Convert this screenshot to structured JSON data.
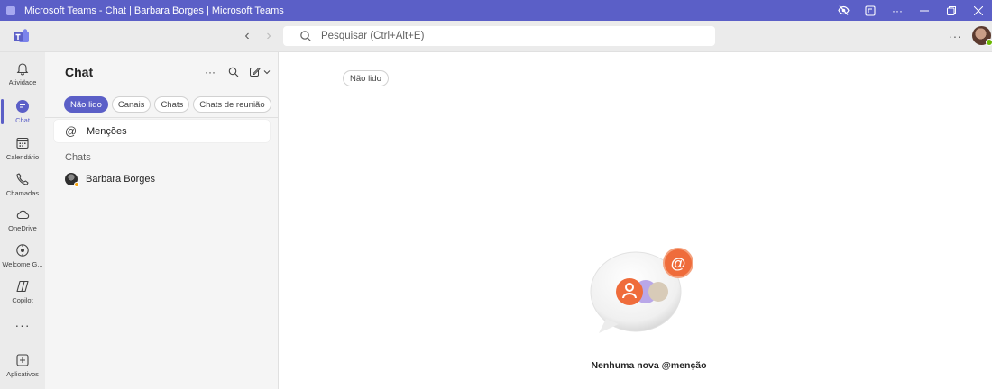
{
  "window": {
    "title": "Microsoft Teams - Chat | Barbara Borges | Microsoft Teams",
    "controls": [
      "visibility-off-icon",
      "share-window-icon",
      "more-icon",
      "minimize-icon",
      "restore-icon",
      "close-icon"
    ]
  },
  "toolbar": {
    "search_placeholder": "Pesquisar (Ctrl+Alt+E)",
    "more": "···"
  },
  "rail": {
    "items": [
      {
        "label": "Atividade",
        "icon": "bell-icon"
      },
      {
        "label": "Chat",
        "icon": "chat-icon",
        "active": true
      },
      {
        "label": "Calendário",
        "icon": "calendar-icon"
      },
      {
        "label": "Chamadas",
        "icon": "phone-icon"
      },
      {
        "label": "OneDrive",
        "icon": "cloud-icon"
      },
      {
        "label": "Welcome G...",
        "icon": "welcome-icon"
      },
      {
        "label": "Copilot",
        "icon": "copilot-icon"
      },
      {
        "label": "Aplicativos",
        "icon": "add-apps-icon"
      }
    ],
    "more": "···"
  },
  "panel": {
    "title": "Chat",
    "more": "···",
    "filters": [
      {
        "label": "Não lido",
        "active": true
      },
      {
        "label": "Canais"
      },
      {
        "label": "Chats"
      },
      {
        "label": "Chats de reunião"
      }
    ],
    "mentions_label": "Menções",
    "section_label": "Chats",
    "chats": [
      {
        "name": "Barbara Borges"
      }
    ]
  },
  "main": {
    "unread_pill": "Não lido",
    "empty_message": "Nenhuma nova @menção"
  },
  "colors": {
    "accent": "#5b5fc7",
    "title_bar": "#5b5fc7",
    "rail_bg": "#ebebeb",
    "panel_bg": "#f5f5f5",
    "mention_orange": "#ef6c3b",
    "mention_lavender": "#b9a7e8"
  }
}
